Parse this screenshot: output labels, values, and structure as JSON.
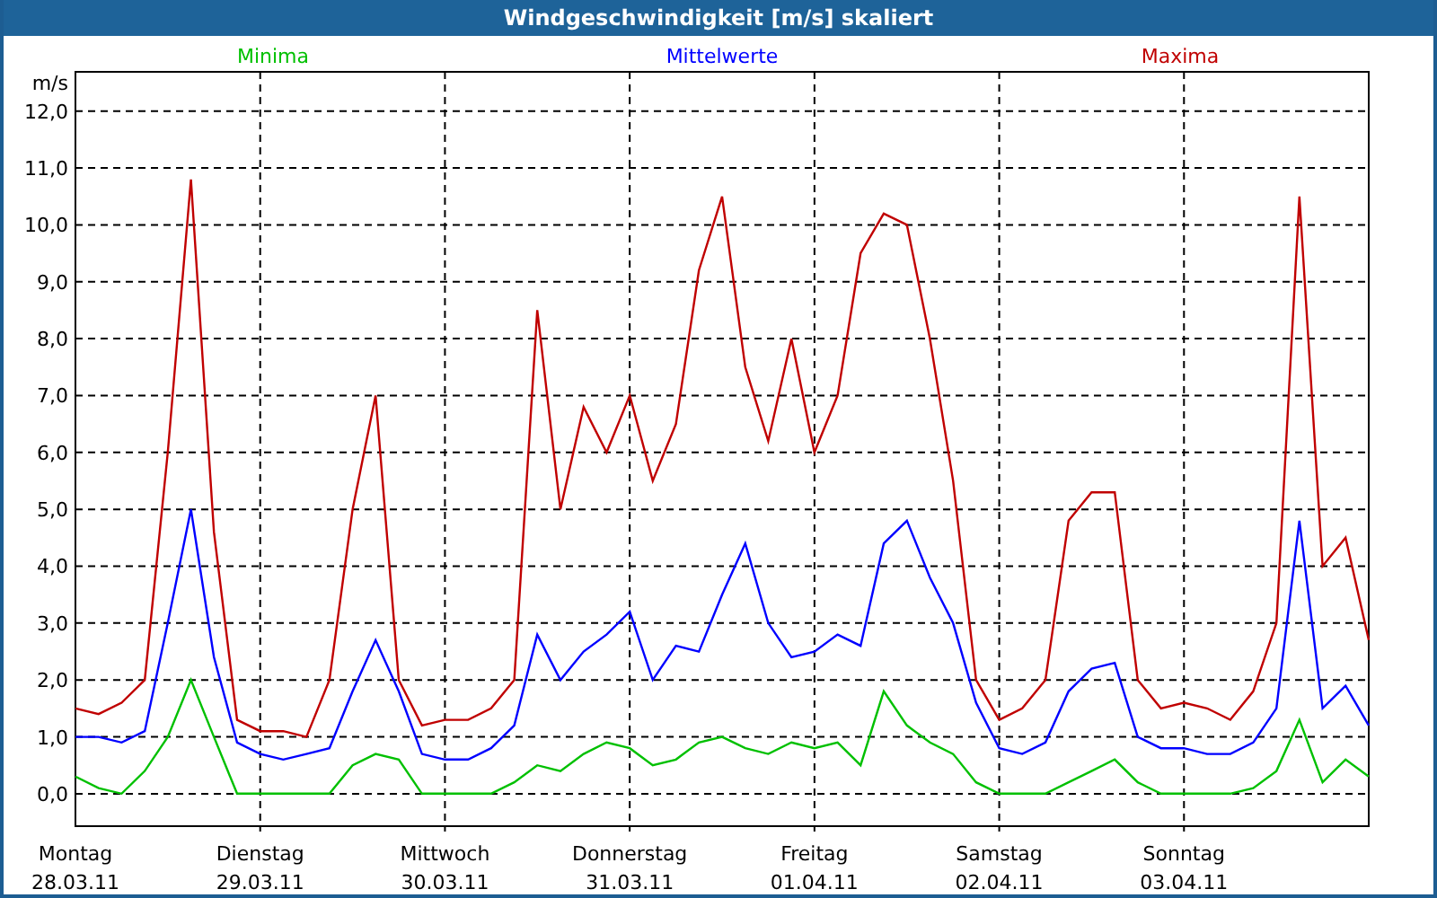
{
  "window": {
    "title": "Windgeschwindigkeit [m/s] skaliert"
  },
  "chart": {
    "chart_data": {
      "type": "line",
      "ylabel": "m/s",
      "grid": true,
      "categories": [
        "Montag",
        null,
        null,
        null,
        null,
        null,
        null,
        null,
        "Dienstag",
        null,
        null,
        null,
        null,
        null,
        null,
        null,
        "Mittwoch",
        null,
        null,
        null,
        null,
        null,
        null,
        null,
        "Donnerstag",
        null,
        null,
        null,
        null,
        null,
        null,
        null,
        "Freitag",
        null,
        null,
        null,
        null,
        null,
        null,
        null,
        "Samstag",
        null,
        null,
        null,
        null,
        null,
        null,
        null,
        "Sonntag",
        null,
        null,
        null,
        null,
        null,
        null,
        null,
        null
      ],
      "series": [
        {
          "name": "Minima",
          "color": "#00c000",
          "values": [
            0.3,
            0.1,
            0.0,
            0.4,
            1.0,
            2.0,
            1.0,
            0.0,
            0.0,
            0.0,
            0.0,
            0.0,
            0.5,
            0.7,
            0.6,
            0.0,
            0.0,
            0.0,
            0.0,
            0.2,
            0.5,
            0.4,
            0.7,
            0.9,
            0.8,
            0.5,
            0.6,
            0.9,
            1.0,
            0.8,
            0.7,
            0.9,
            0.8,
            0.9,
            0.5,
            1.8,
            1.2,
            0.9,
            0.7,
            0.2,
            0.0,
            0.0,
            0.0,
            0.2,
            0.4,
            0.6,
            0.2,
            0.0,
            0.0,
            0.0,
            0.0,
            0.1,
            0.4,
            1.3,
            0.2,
            0.6,
            0.3
          ]
        },
        {
          "name": "Mittelwerte",
          "color": "#0000ff",
          "values": [
            1.0,
            1.0,
            0.9,
            1.1,
            3.0,
            5.0,
            2.4,
            0.9,
            0.7,
            0.6,
            0.7,
            0.8,
            1.8,
            2.7,
            1.8,
            0.7,
            0.6,
            0.6,
            0.8,
            1.2,
            2.8,
            2.0,
            2.5,
            2.8,
            3.2,
            2.0,
            2.6,
            2.5,
            3.5,
            4.4,
            3.0,
            2.4,
            2.5,
            2.8,
            2.6,
            4.4,
            4.8,
            3.8,
            3.0,
            1.6,
            0.8,
            0.7,
            0.9,
            1.8,
            2.2,
            2.3,
            1.0,
            0.8,
            0.8,
            0.7,
            0.7,
            0.9,
            1.5,
            4.8,
            1.5,
            1.9,
            1.2
          ]
        },
        {
          "name": "Maxima",
          "color": "#c00000",
          "values": [
            1.5,
            1.4,
            1.6,
            2.0,
            6.0,
            10.8,
            4.6,
            1.3,
            1.1,
            1.1,
            1.0,
            2.0,
            5.0,
            7.0,
            2.0,
            1.2,
            1.3,
            1.3,
            1.5,
            2.0,
            8.5,
            5.0,
            6.8,
            6.0,
            7.0,
            5.5,
            6.5,
            9.2,
            10.5,
            7.5,
            6.2,
            8.0,
            6.0,
            7.0,
            9.5,
            10.2,
            10.0,
            8.0,
            5.5,
            2.0,
            1.3,
            1.5,
            2.0,
            4.8,
            5.3,
            5.3,
            2.0,
            1.5,
            1.6,
            1.5,
            1.3,
            1.8,
            3.0,
            10.5,
            4.0,
            4.5,
            2.7
          ]
        }
      ],
      "ylim": [
        -0.57,
        12.69
      ],
      "yticks": [
        {
          "value": 0,
          "label": "0,0"
        },
        {
          "value": 1,
          "label": "1,0"
        },
        {
          "value": 2,
          "label": "2,0"
        },
        {
          "value": 3,
          "label": "3,0"
        },
        {
          "value": 4,
          "label": "4,0"
        },
        {
          "value": 5,
          "label": "5,0"
        },
        {
          "value": 6,
          "label": "6,0"
        },
        {
          "value": 7,
          "label": "7,0"
        },
        {
          "value": 8,
          "label": "8,0"
        },
        {
          "value": 9,
          "label": "9,0"
        },
        {
          "value": 10,
          "label": "10,0"
        },
        {
          "value": 11,
          "label": "11,0"
        },
        {
          "value": 12,
          "label": "12,0"
        }
      ]
    },
    "date_labels": [
      "28.03.11",
      "29.03.11",
      "30.03.11",
      "31.03.11",
      "01.04.11",
      "02.04.11",
      "03.04.11"
    ]
  }
}
